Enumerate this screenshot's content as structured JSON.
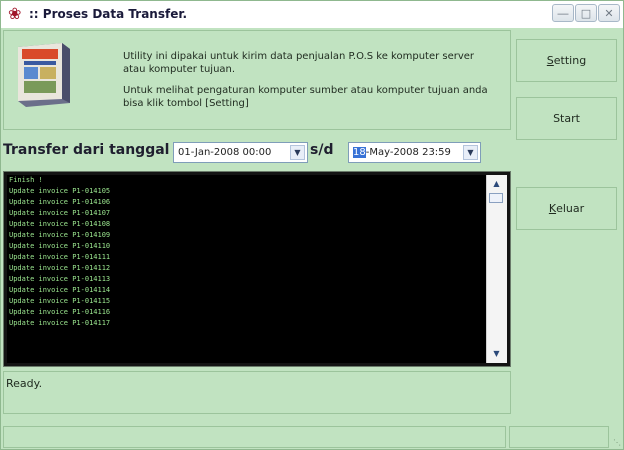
{
  "window": {
    "title": ":: Proses Data Transfer.",
    "icon": "ornament-icon",
    "controls": [
      "minimize",
      "maximize",
      "close"
    ]
  },
  "info": {
    "line1": "Utility ini dipakai untuk kirim data penjualan P.O.S ke komputer server atau komputer tujuan.",
    "line2": "Untuk melihat pengaturan  komputer sumber atau komputer tujuan anda bisa klik tombol [Setting]"
  },
  "transfer": {
    "label": "Transfer dari tanggal",
    "sd_label": "s/d",
    "from_value": "01-Jan-2008 00:00",
    "to_day": "18",
    "to_rest": "-May-2008 23:59"
  },
  "log": {
    "lines": [
      "Finish !",
      "Update invoice P1-014105",
      "Update invoice P1-014106",
      "Update invoice P1-014107",
      "Update invoice P1-014108",
      "Update invoice P1-014109",
      "Update invoice P1-014110",
      "Update invoice P1-014111",
      "Update invoice P1-014112",
      "Update invoice P1-014113",
      "Update invoice P1-014114",
      "Update invoice P1-014115",
      "Update invoice P1-014116",
      "Update invoice P1-014117"
    ]
  },
  "status": {
    "text": "Ready."
  },
  "buttons": {
    "setting_accel": "S",
    "setting_rest": "etting",
    "start": "Start",
    "keluar_accel": "K",
    "keluar_rest": "eluar"
  },
  "colors": {
    "background": "#c1e3c1",
    "log_text": "#9be68f",
    "log_bg": "#000000"
  }
}
